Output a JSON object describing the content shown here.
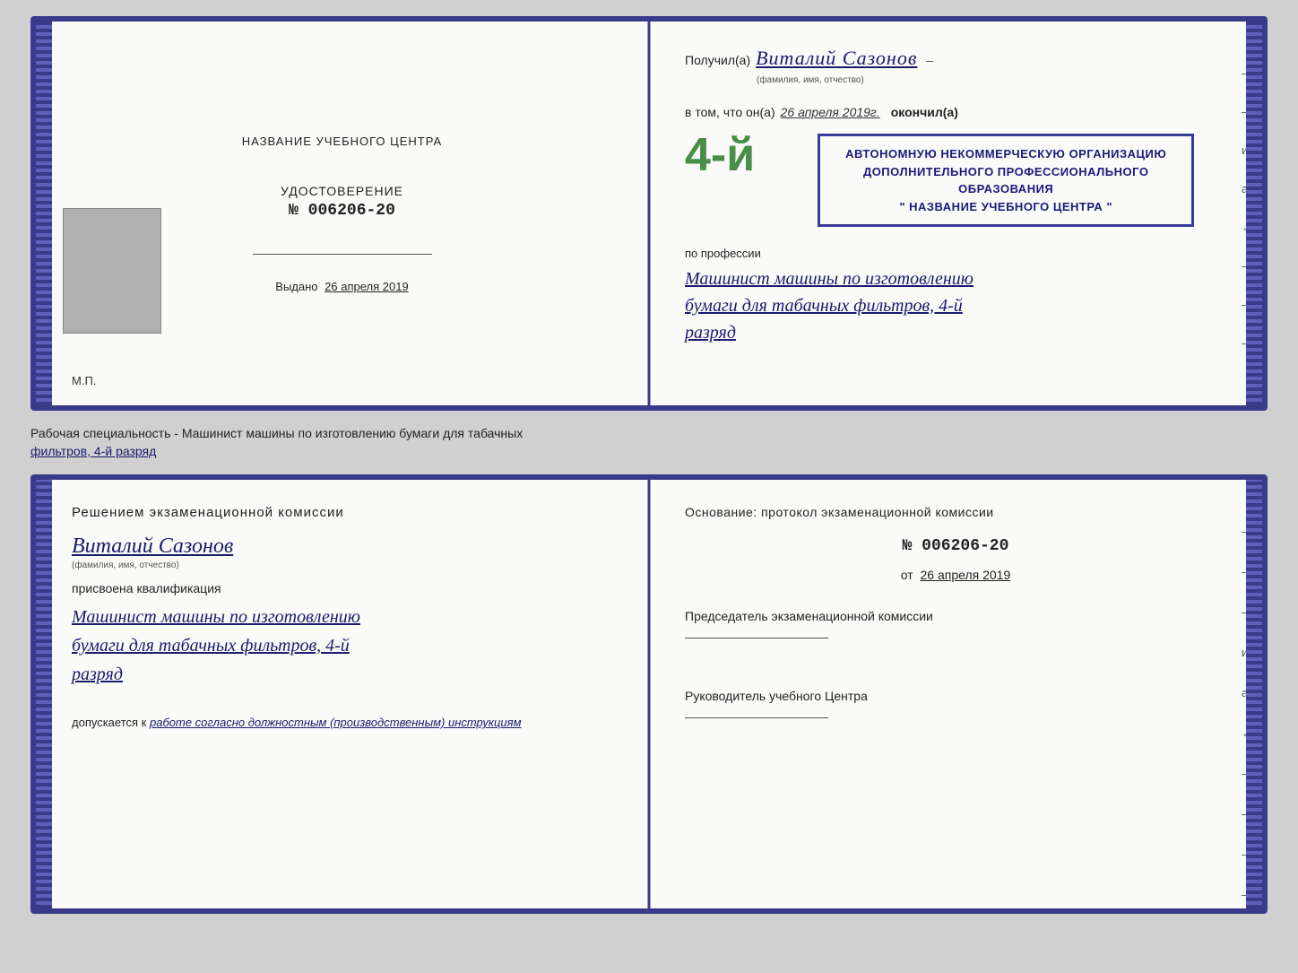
{
  "cert_top": {
    "left": {
      "training_center_label": "НАЗВАНИЕ УЧЕБНОГО ЦЕНТРА",
      "udostoverenie_title": "УДОСТОВЕРЕНИЕ",
      "number": "№ 006206-20",
      "vydano_label": "Выдано",
      "vydano_date": "26 апреля 2019",
      "mp_label": "М.П."
    },
    "right": {
      "poluchil_label": "Получил(а)",
      "poluchil_name": "Виталий Сазонов",
      "fio_subtitle": "(фамилия, имя, отчество)",
      "hyphen": "–",
      "vtom_label": "в том, что он(а)",
      "vtom_date": "26 апреля 2019г.",
      "okonchil_label": "окончил(а)",
      "big_number": "4-й",
      "stamp_line1": "АВТОНОМНУЮ НЕКОММЕРЧЕСКУЮ ОРГАНИЗАЦИЮ",
      "stamp_line2": "ДОПОЛНИТЕЛЬНОГО ПРОФЕССИОНАЛЬНОГО ОБРАЗОВАНИЯ",
      "stamp_line3": "\" НАЗВАНИЕ УЧЕБНОГО ЦЕНТРА \"",
      "po_professii_label": "по профессии",
      "profession_line1": "Машинист машины по изготовлению",
      "profession_line2": "бумаги для табачных фильтров, 4-й",
      "profession_line3": "разряд",
      "side_dashes": [
        "–",
        "–",
        "и",
        "а",
        "←",
        "–",
        "–",
        "–"
      ]
    }
  },
  "info_text": {
    "line1": "Рабочая специальность - Машинист машины по изготовлению бумаги для табачных",
    "line2_underlined": "фильтров, 4-й разряд"
  },
  "cert_bottom": {
    "left": {
      "resheniem_label": "Решением экзаменационной комиссии",
      "fio_name": "Виталий Сазонов",
      "fio_subtitle": "(фамилия, имя, отчество)",
      "prisvoena_label": "присвоена квалификация",
      "qual_line1": "Машинист машины по изготовлению",
      "qual_line2": "бумаги для табачных фильтров, 4-й",
      "qual_line3": "разряд",
      "dopuskaetsya_label": "допускается к",
      "dopuskaetsya_value": "работе согласно должностным (производственным) инструкциям"
    },
    "right": {
      "osnovanie_label": "Основание: протокол экзаменационной комиссии",
      "protocol_number": "№ 006206-20",
      "ot_label": "от",
      "ot_date": "26 апреля 2019",
      "chairman_label": "Председатель экзаменационной комиссии",
      "rukovoditel_label": "Руководитель учебного Центра",
      "side_dashes": [
        "–",
        "–",
        "–",
        "и",
        "а",
        "←",
        "–",
        "–",
        "–",
        "–"
      ]
    }
  }
}
